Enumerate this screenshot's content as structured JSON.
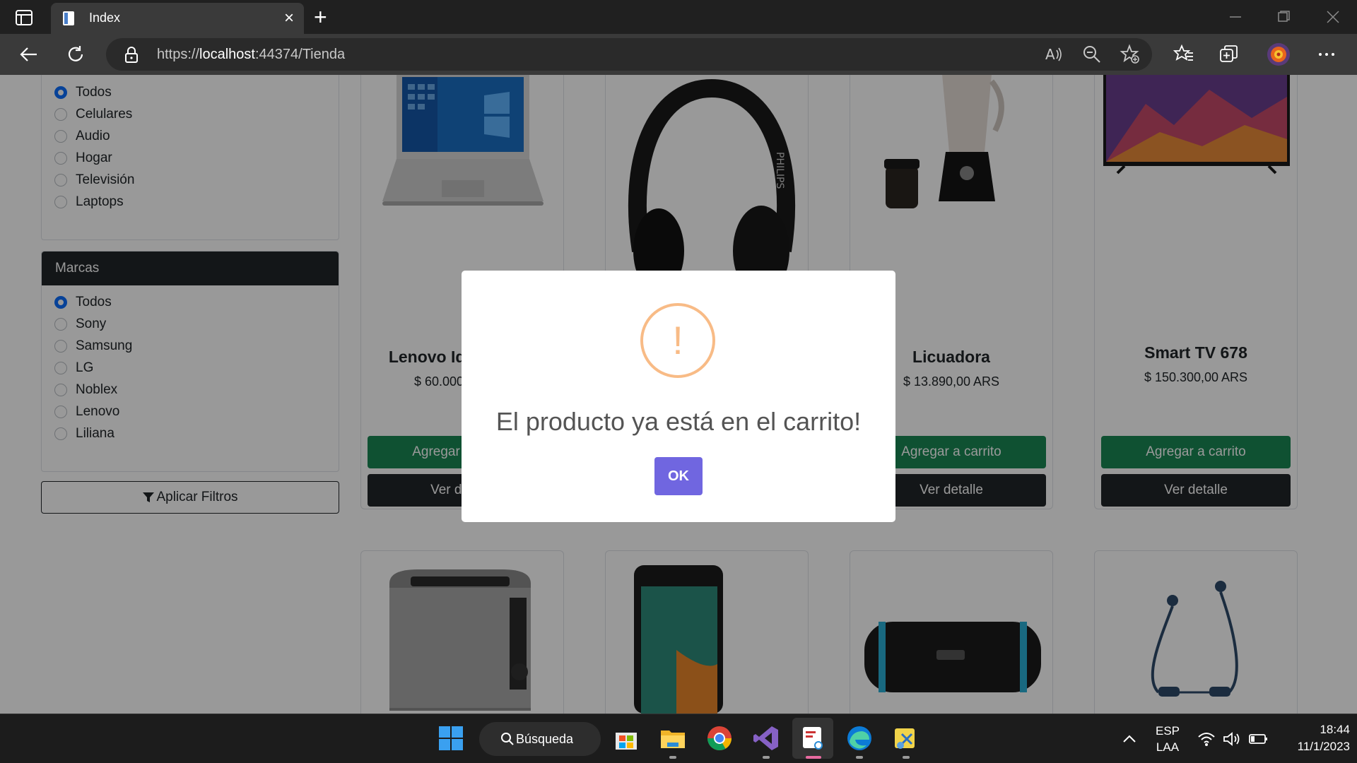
{
  "browser": {
    "tab_title": "Index",
    "tab_close": "×",
    "new_tab": "+",
    "url_scheme": "https://",
    "url_host": "localhost",
    "url_path": ":44374/Tienda",
    "window_controls": [
      "minimize",
      "restore",
      "close"
    ]
  },
  "filters": {
    "categories": {
      "options": [
        "Todos",
        "Celulares",
        "Audio",
        "Hogar",
        "Televisión",
        "Laptops"
      ],
      "selected": "Todos"
    },
    "brands": {
      "title": "Marcas",
      "options": [
        "Todos",
        "Sony",
        "Samsung",
        "LG",
        "Noblex",
        "Lenovo",
        "Liliana"
      ],
      "selected": "Todos"
    },
    "apply_label": "Aplicar Filtros"
  },
  "products": [
    {
      "name": "Lenovo IdeaPad 20",
      "price": "$ 60.000,00 ARS",
      "image": "laptop"
    },
    {
      "name": "",
      "price": "",
      "image": "headphones"
    },
    {
      "name": "Licuadora",
      "price": "$ 13.890,00 ARS",
      "image": "blender"
    },
    {
      "name": "Smart TV 678",
      "price": "$ 150.300,00 ARS",
      "image": "tv"
    }
  ],
  "products_row2": [
    "toaster",
    "smartphone",
    "speaker",
    "earphones"
  ],
  "card_buttons": {
    "add": "Agregar a carrito",
    "detail": "Ver detalle"
  },
  "modal": {
    "icon": "!",
    "message": "El producto ya está en el carrito!",
    "ok_label": "OK",
    "icon_color": "#f8bb86",
    "button_color": "#7066e0"
  },
  "taskbar": {
    "search_label": "Búsqueda",
    "lang_line1": "ESP",
    "lang_line2": "LAA",
    "time": "18:44",
    "date": "11/1/2023"
  },
  "colors": {
    "add_button": "#198754",
    "detail_button": "#212529",
    "radio_checked": "#0d6efd"
  }
}
